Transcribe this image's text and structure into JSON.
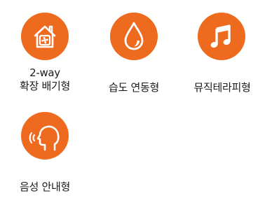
{
  "colors": {
    "accent": "#EE6A1E",
    "icon_stroke": "#FFFFFF",
    "text": "#1A1A1A"
  },
  "features": [
    {
      "icon": "house-fan-icon",
      "label_lines": [
        "2-way",
        "확장 배기형"
      ]
    },
    {
      "icon": "water-drop-icon",
      "label_lines": [
        "습도 연동형"
      ]
    },
    {
      "icon": "music-note-icon",
      "label_lines": [
        "뮤직테라피형"
      ]
    },
    {
      "icon": "voice-guide-icon",
      "label_lines": [
        "음성 안내형"
      ]
    }
  ]
}
